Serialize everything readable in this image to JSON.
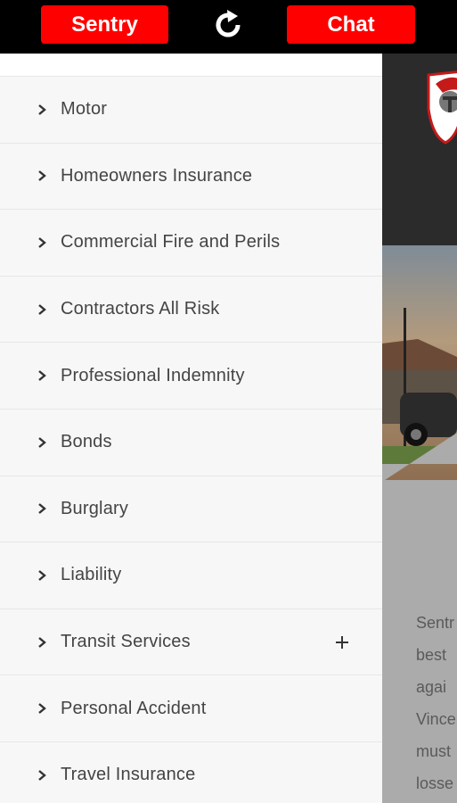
{
  "topbar": {
    "sentry_label": "Sentry",
    "chat_label": "Chat",
    "refresh_icon": "refresh-icon"
  },
  "menu": {
    "items": [
      {
        "label": "Motor",
        "icon": "chevron-right-icon"
      },
      {
        "label": "Homeowners Insurance",
        "icon": "chevron-right-icon"
      },
      {
        "label": "Commercial Fire and Perils",
        "icon": "chevron-right-icon"
      },
      {
        "label": "Contractors All Risk",
        "icon": "chevron-right-icon"
      },
      {
        "label": "Professional Indemnity",
        "icon": "chevron-right-icon"
      },
      {
        "label": "Bonds",
        "icon": "chevron-right-icon"
      },
      {
        "label": "Burglary",
        "icon": "chevron-right-icon"
      },
      {
        "label": "Liability",
        "icon": "chevron-right-icon"
      },
      {
        "label": "Transit Services",
        "icon": "chevron-right-icon",
        "expand_icon": "plus-icon"
      },
      {
        "label": "Personal Accident",
        "icon": "chevron-right-icon"
      },
      {
        "label": "Travel Insurance",
        "icon": "chevron-right-icon"
      }
    ]
  },
  "background_page": {
    "logo_icon": "spartan-helmet-shield-logo",
    "text_lines": [
      "Sentr",
      "best",
      "agai",
      "Vince",
      "must",
      "losse"
    ]
  },
  "colors": {
    "accent": "#ff0000",
    "topbar": "#000000",
    "drawer_bg": "#f7f7f7",
    "divider": "#e7e7e7",
    "header_dark": "#2b2b2b"
  }
}
